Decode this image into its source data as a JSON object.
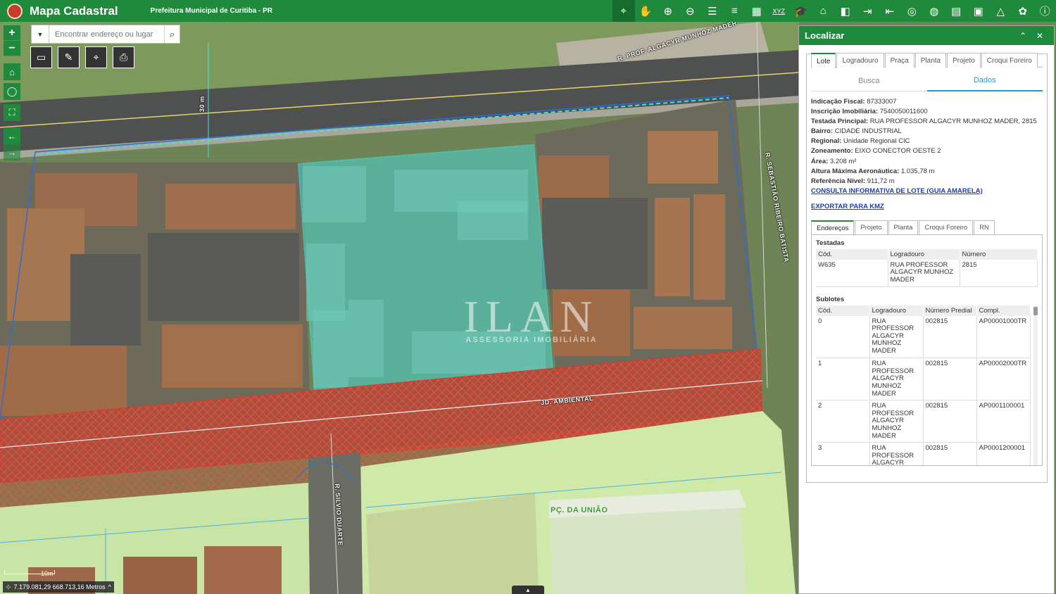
{
  "app": {
    "title": "Mapa Cadastral",
    "subtitle": "Prefeitura Municipal de Curitiba - PR"
  },
  "toolbar": {
    "icons": [
      "identify-icon",
      "pan-icon",
      "zoom-in-icon",
      "zoom-out-icon",
      "layers-icon",
      "list-icon",
      "grid-icon",
      "xyz-icon",
      "education-icon",
      "building-icon",
      "compare-icon",
      "login-icon",
      "logout-icon",
      "target-icon",
      "globe-icon",
      "map-tool-icon",
      "overlay-icon",
      "measure-area-icon",
      "settings-icon",
      "info-icon"
    ],
    "xyz_label": "XYZ"
  },
  "search": {
    "placeholder": "Encontrar endereço ou lugar"
  },
  "map": {
    "labels": {
      "street_top": "R. PROF. ALGACYR MUNHOZ MADER",
      "street_right": "R. SEBASTIÃO RIBEIRO BATISTA",
      "street_bottom": "JD. AMBIENTAL",
      "street_left": "R. SILVIO DUARTE",
      "square": "PÇ. DA UNIÃO",
      "dimension": "30 m"
    },
    "coordinates": "7.179.081,29 668.713,16 Metros",
    "scale_label": "10m",
    "watermark_big": "ILAN",
    "watermark_small": "ASSESSORIA IMOBILIÁRIA"
  },
  "panel": {
    "title": "Localizar",
    "tabs": [
      "Lote",
      "Logradouro",
      "Praça",
      "Planta",
      "Projeto",
      "Croqui Foreiro"
    ],
    "active_tab": "Lote",
    "subtabs": [
      "Busca",
      "Dados"
    ],
    "active_subtab": "Dados",
    "fields": [
      {
        "label": "Indicação Fiscal:",
        "value": "87333007"
      },
      {
        "label": "Inscrição Imobiliária:",
        "value": "7540050011600"
      },
      {
        "label": "Testada Principal:",
        "value": "RUA PROFESSOR ALGACYR MUNHOZ MADER, 2815"
      },
      {
        "label": "Bairro:",
        "value": "CIDADE INDUSTRIAL"
      },
      {
        "label": "Regional:",
        "value": "Unidade Regional CIC"
      },
      {
        "label": "Zoneamento:",
        "value": "EIXO CONECTOR OESTE 2"
      },
      {
        "label": "Área:",
        "value": "3.208 m²"
      },
      {
        "label": "Altura Máxima Aeronáutica:",
        "value": "1.035,78 m"
      },
      {
        "label": "Referência Nível:",
        "value": "911,72 m"
      }
    ],
    "link_consulta": "CONSULTA INFORMATIVA DE LOTE (GUIA AMARELA)",
    "link_export": "EXPORTAR PARA KMZ",
    "inner_tabs": [
      "Endereços",
      "Projeto",
      "Planta",
      "Croqui Foreiro",
      "RN"
    ],
    "active_inner_tab": "Endereços",
    "testadas": {
      "title": "Testadas",
      "headers": [
        "Cód.",
        "Logradouro",
        "Número"
      ],
      "rows": [
        [
          "W635",
          "RUA PROFESSOR ALGACYR MUNHOZ MADER",
          "2815"
        ]
      ]
    },
    "sublotes": {
      "title": "Sublotes",
      "headers": [
        "Cód.",
        "Logradouro",
        "Número Predial",
        "Compl."
      ],
      "rows": [
        [
          "0",
          "RUA PROFESSOR ALGACYR MUNHOZ MADER",
          "002815",
          "AP00001000TR"
        ],
        [
          "1",
          "RUA PROFESSOR ALGACYR MUNHOZ MADER",
          "002815",
          "AP00002000TR"
        ],
        [
          "2",
          "RUA PROFESSOR ALGACYR MUNHOZ MADER",
          "002815",
          "AP0001100001"
        ],
        [
          "3",
          "RUA PROFESSOR ALGACYR",
          "002815",
          "AP0001200001"
        ]
      ]
    }
  },
  "colors": {
    "brand_green": "#1f8a3c",
    "link_blue": "#1a3fa8",
    "active_subtab": "#1f9bd1",
    "lot_highlight": "#3fe0e0",
    "zone_red": "#e23a3a",
    "zone_green": "#d6f3a8"
  }
}
